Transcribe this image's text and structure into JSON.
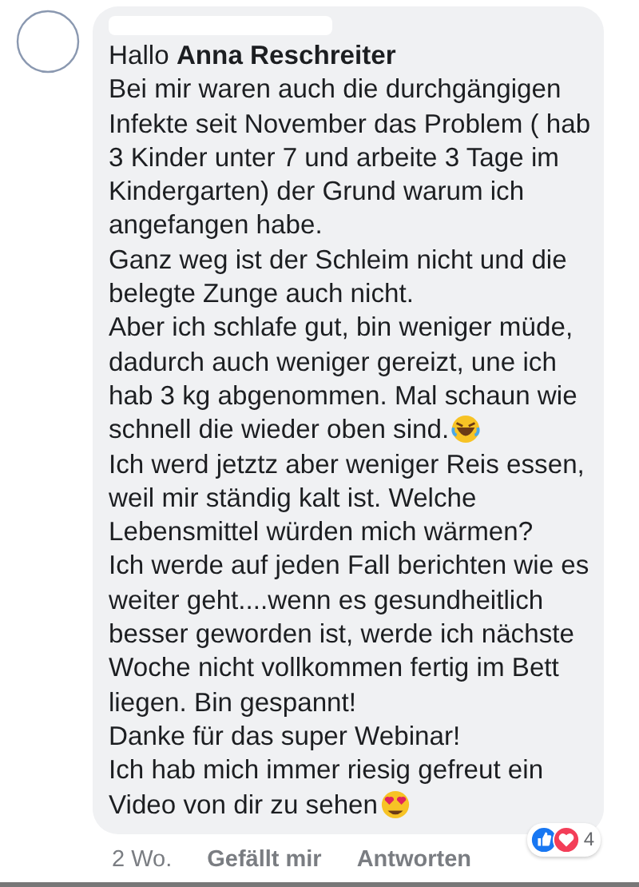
{
  "comment": {
    "greeting": "Hallo **Anna Reschreiter**",
    "lines": [
      {
        "kind": "plain",
        "text": "Bei mir waren auch die durchgängigen"
      },
      {
        "kind": "plain",
        "text": "Infekte seit November das Problem ( hab"
      },
      {
        "kind": "plain",
        "text": "3 Kinder unter 7 und arbeite 3 Tage im"
      },
      {
        "kind": "plain",
        "text": "Kindergarten) der Grund warum ich"
      },
      {
        "kind": "plain",
        "text": "angefangen habe."
      },
      {
        "kind": "plain",
        "text": "Ganz weg ist der Schleim nicht und die"
      },
      {
        "kind": "plain",
        "text": "belegte Zunge auch nicht."
      },
      {
        "kind": "plain",
        "text": "Aber ich schlafe gut, bin weniger müde,"
      },
      {
        "kind": "plain",
        "text": "dadurch auch weniger gereizt, une ich"
      },
      {
        "kind": "plain",
        "text": "hab 3 kg abgenommen. Mal schaun wie"
      },
      {
        "kind": "laughing",
        "text": "schnell die wieder oben sind."
      },
      {
        "kind": "plain",
        "text": "Ich werd jetztz aber weniger Reis essen,"
      },
      {
        "kind": "plain",
        "text": "weil mir ständig kalt ist. Welche"
      },
      {
        "kind": "plain",
        "text": "Lebensmittel würden mich wärmen?"
      },
      {
        "kind": "plain",
        "text": "Ich werde auf jeden Fall berichten wie es"
      },
      {
        "kind": "plain",
        "text": "weiter geht....wenn es gesundheitlich"
      },
      {
        "kind": "plain",
        "text": "besser geworden ist, werde ich nächste"
      },
      {
        "kind": "plain",
        "text": "Woche nicht vollkommen fertig im Bett"
      },
      {
        "kind": "plain",
        "text": "liegen. Bin gespannt!"
      },
      {
        "kind": "plain",
        "text": "Danke für das super Webinar!"
      },
      {
        "kind": "plain",
        "text": "Ich hab mich immer riesig gefreut ein"
      },
      {
        "kind": "hearteyes",
        "text": "Video von dir zu sehen"
      }
    ],
    "reactions": [
      {
        "kind": "like"
      },
      {
        "kind": "love"
      }
    ],
    "reaction_count": "4"
  },
  "actions": {
    "time": "2 Wo.",
    "like": "Gefällt mir",
    "reply": "Antworten"
  }
}
